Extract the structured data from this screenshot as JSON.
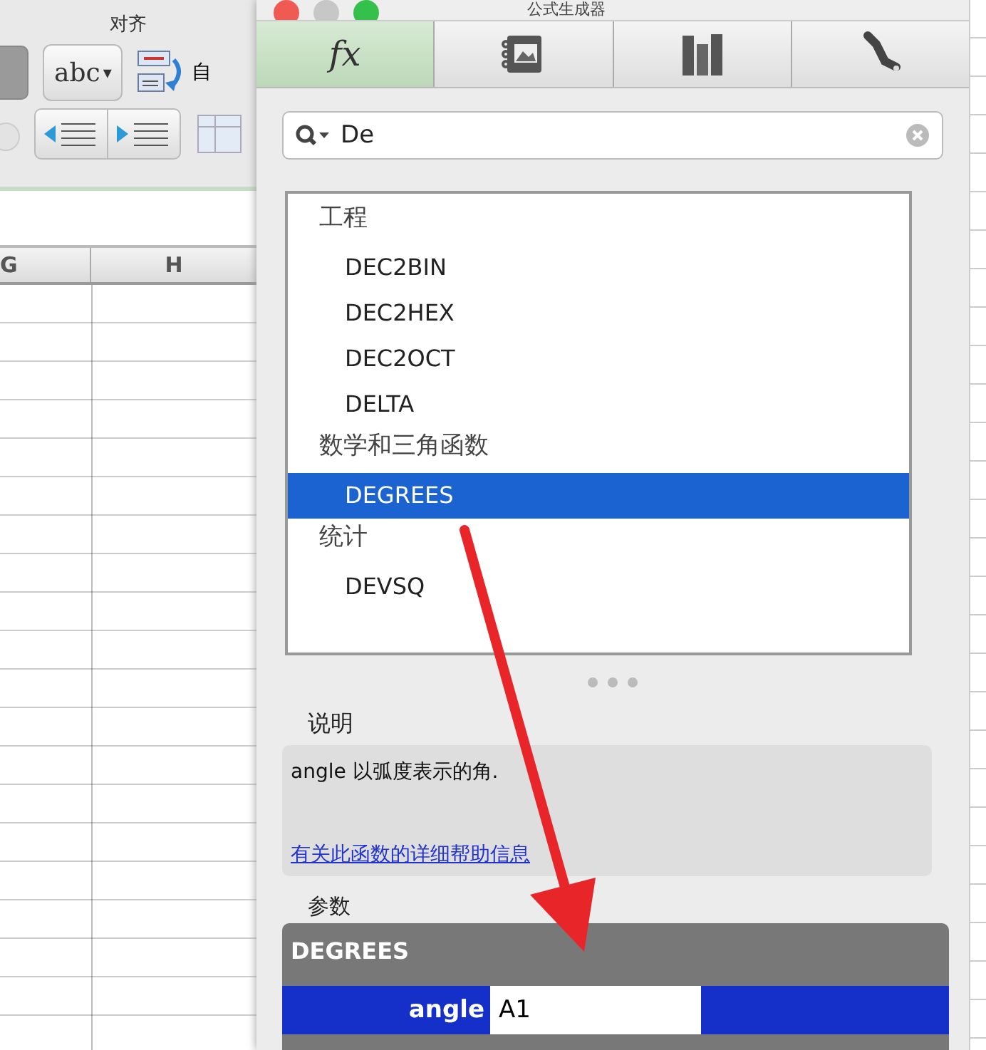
{
  "ribbon": {
    "group_label": "对齐",
    "orientation_button": "abc",
    "orientation_caret": "▾",
    "wrap_text_label": "自"
  },
  "sheet": {
    "columns": [
      "G",
      "H"
    ]
  },
  "dialog": {
    "title": "公式生成器",
    "tabs": [
      {
        "kind": "fx",
        "label": "fx",
        "selected": true
      },
      {
        "kind": "media",
        "selected": false
      },
      {
        "kind": "books",
        "selected": false
      },
      {
        "kind": "wrench",
        "selected": false
      }
    ],
    "search": {
      "value": "De"
    },
    "categories": [
      {
        "label": "工程",
        "children": [
          {
            "label": "DEC2BIN",
            "selected": false
          },
          {
            "label": "DEC2HEX",
            "selected": false
          },
          {
            "label": "DEC2OCT",
            "selected": false
          },
          {
            "label": "DELTA",
            "selected": false
          }
        ]
      },
      {
        "label": "数学和三角函数",
        "children": [
          {
            "label": "DEGREES",
            "selected": true
          }
        ]
      },
      {
        "label": "统计",
        "children": [
          {
            "label": "DEVSQ",
            "selected": false
          }
        ]
      }
    ],
    "description": {
      "heading": "说明",
      "text": "angle 以弧度表示的角.",
      "help_link": "有关此函数的详细帮助信息"
    },
    "arguments": {
      "heading": "参数",
      "function": "DEGREES",
      "rows": [
        {
          "name": "angle",
          "value": "A1"
        }
      ]
    }
  }
}
